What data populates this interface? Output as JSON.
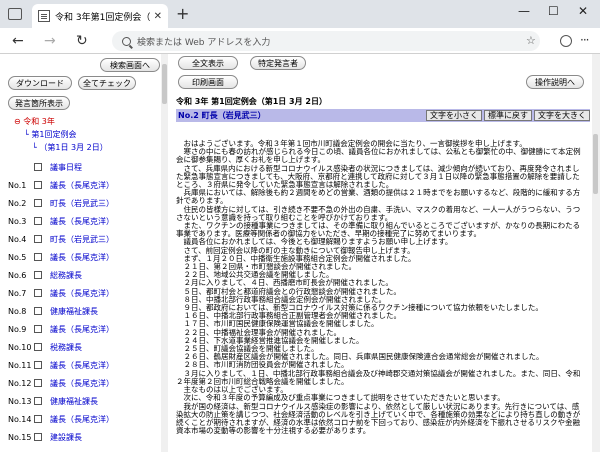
{
  "browser": {
    "tab_title": "令和 3年第1回定例会（第1日 3月",
    "tab_close": "✕",
    "newtab": "+",
    "address_placeholder": "検索または Web アドレスを入力",
    "controls": {
      "minimize": "—",
      "maximize": "☐",
      "close": "✕"
    }
  },
  "left": {
    "buttons": {
      "search_screen": "検索画面へ",
      "download": "ダウンロード",
      "check_all": "全てチェック",
      "speaker_list": "発言箇所表示"
    },
    "tree": {
      "era": "令和 3年",
      "session": "第1回定例会",
      "day": "（第1日 3月 2日）"
    },
    "rows": [
      {
        "num": "",
        "label": "議事日程"
      },
      {
        "num": "No.1",
        "label": "議長（長尾克洋）"
      },
      {
        "num": "No.2",
        "label": "町長（岩見武三）"
      },
      {
        "num": "No.3",
        "label": "議長（長尾克洋）"
      },
      {
        "num": "No.4",
        "label": "町長（岩見武三）"
      },
      {
        "num": "No.5",
        "label": "議長（長尾克洋）"
      },
      {
        "num": "No.6",
        "label": "総務課長"
      },
      {
        "num": "No.7",
        "label": "議長（長尾克洋）"
      },
      {
        "num": "No.8",
        "label": "健康福祉課長"
      },
      {
        "num": "No.9",
        "label": "議長（長尾克洋）"
      },
      {
        "num": "No.10",
        "label": "税務課長"
      },
      {
        "num": "No.11",
        "label": "議長（長尾克洋）"
      },
      {
        "num": "No.12",
        "label": "議長（長尾克洋）"
      },
      {
        "num": "No.13",
        "label": "健康福祉課長"
      },
      {
        "num": "No.14",
        "label": "議長（長尾克洋）"
      },
      {
        "num": "No.15",
        "label": "建設課長"
      }
    ]
  },
  "right": {
    "buttons": {
      "show_all": "全文表示",
      "specific_speaker": "特定発言者",
      "print_screen": "印刷画面",
      "help": "操作説明へ"
    },
    "heading": "令和 3年 第1回定例会（第1日 3月 2日）",
    "speaker": "No.2 町長（岩見武三）",
    "size_buttons": {
      "smaller": "文字を小さく",
      "normal": "標準に戻す",
      "larger": "文字を大きく"
    },
    "body": [
      "　おはようございます。令和３年第１回市川町議会定例会の開会に当たり、一言御挨拶を申し上げます。",
      "　寒さの中にも春の訪れが感じられる今日この頃、議員各位におかれましては、公私とも御繁忙の中、御健勝にて本定例会に御参集賜り、厚くお礼を申し上げます。",
      "　さて、兵庫県内における新型コロナウイルス感染者の状況につきましては、減少傾向が続いており、再度発令されました緊急事態宣言につきましても、大阪府、京都府と連携して政府に対して３月１日以降の緊急事態措置の解除を要請したところ、３府県に発令していた緊急事態宣言は解除されました。",
      "　兵庫県においては、解除後も約２週間をめどの営業、酒類の提供は２１時までをお願いするなど、段階的に緩和する方針であります。",
      "　住民の皆様方に対しては、引き続き不要不急の外出の自粛、手洗い、マスクの着用など、一人一人がうつらない、うつさないという意識を持って取り組むことを呼びかけております。",
      "　また、ワクチンの接種事業につきましては、その準備に取り組んでいるところでございますが、かなりの長期にわたる事業であります。医療等関係者の御協力をいただき、早期の接種完了に努めてまいります。",
      "　議員各位におかれましては、今後とも御理解賜りますようお願い申し上げます。",
      "　さて、前回定例会以降の町の主な動きについて御報告申し上げます。",
      "　まず、１月２０日、中播衛生施設事務組合定例会が開催されました。",
      "　２１日、第２回県・市町懇談会が開催されました。",
      "　２２日、地域公共交通会議を開催しました。",
      "　２月に入りまして、４日、西播磨市町長会が開催されました。",
      "　５日、都町村会と都道府議会との行政懇談会が開催されました。",
      "　８日、中播北部行政事務組合議会定例会が開催されました。",
      "　９日、都政府においては、新型コロナウイルス対策に係るワクチン接種について協力依頼をいたしました。",
      "　１６日、中播北部行政事務組合正副管理者会が開催されました。",
      "　１７日、市川町国民健康保険運営協議会を開催しました。",
      "　２２日、中播福祉会理事会が開催されました。",
      "　２４日、下水道事業経営推進協議会を開催しました。",
      "　２５日、町議会協議会を開催しました。",
      "　２６日、鶴居財産区議会が開催されました。同日、兵庫県国民健康保険連合会通常総会が開催されました。",
      "　２８日、市川町消防団役員会が開催されました。",
      "　３月に入りまして、１日、中播北部行政事務組合議会及び神崎郡交通対策協議会が開催されました。また、同日、令和２年度第２回市川町総合戦略会議を開催しました。",
      "　主なものは以上でございます。",
      "　次に、令和３年度の予算編成及び重点事業につきまして説明をさせていただきたいと思います。",
      "　我が国の経済は、新型コロナウイルス感染症の影響により、依然として厳しい状況にあります。先行きについては、感染拡大の防止策を講じつつ、社会経済活動のレベルを引き上げていく中で、各種施策の効果などにより持ち直しの動きが続くことが期待されますが、経済の水準は依然コロナ前を下回っており、感染症が内外経済を下振れさせるリスクや金融資本市場の変動等の影響を十分注視する必要があります。"
    ]
  }
}
